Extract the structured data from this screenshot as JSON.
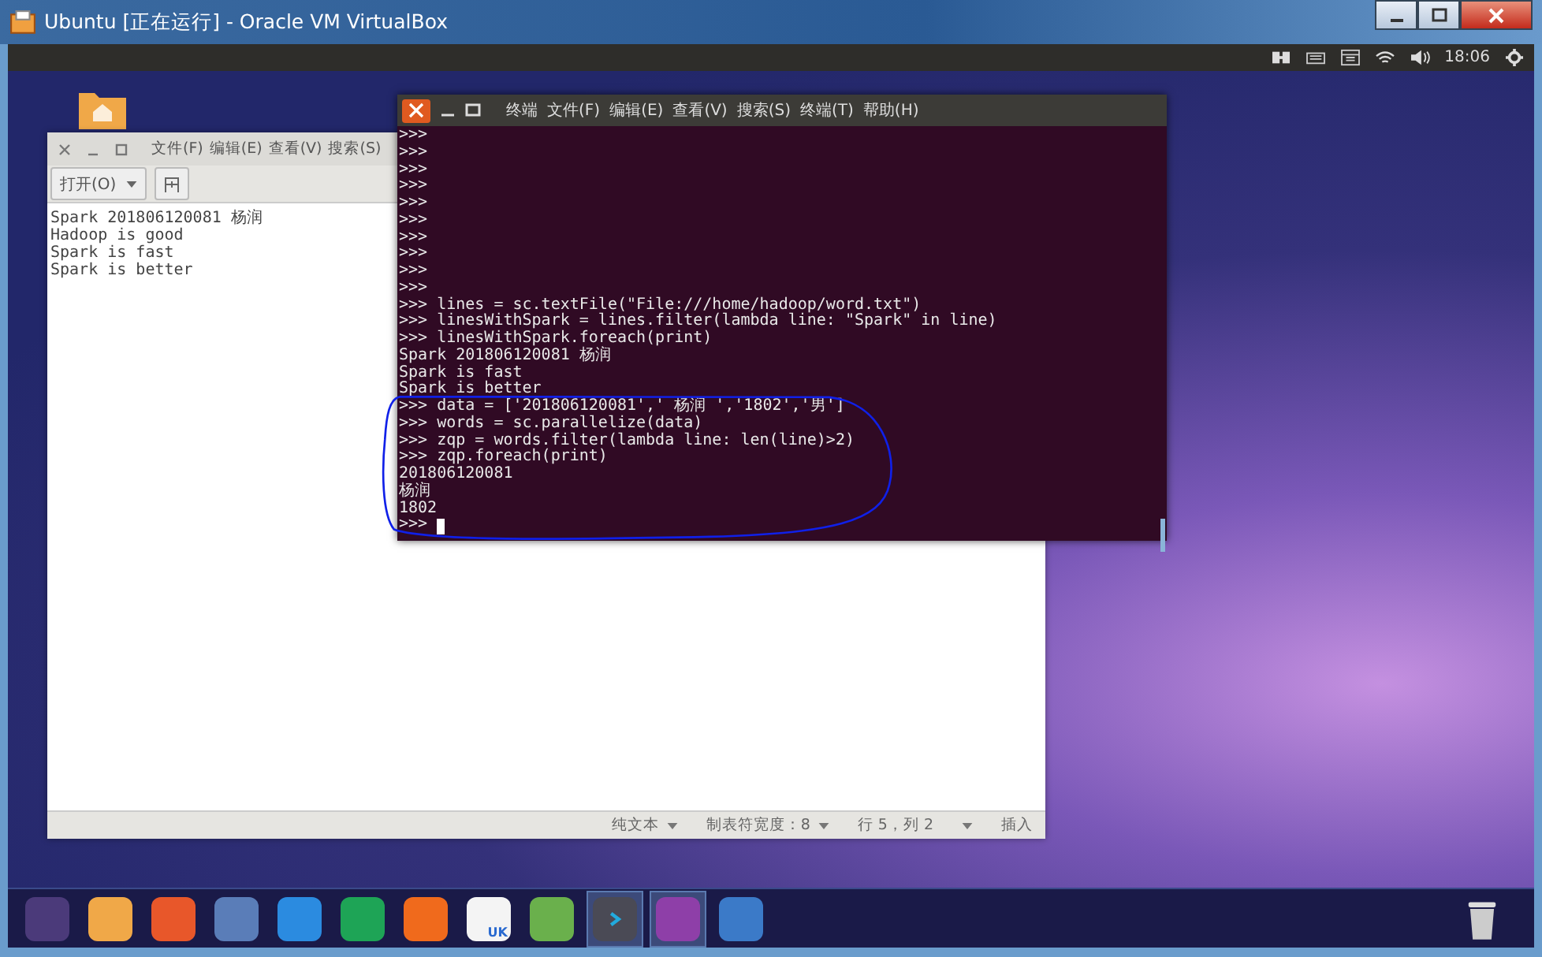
{
  "window": {
    "title": "Ubuntu [正在运行] - Oracle VM VirtualBox"
  },
  "top_panel": {
    "time": "18:06"
  },
  "gedit": {
    "menu": [
      "文件(F)",
      "编辑(E)",
      "查看(V)",
      "搜索(S)"
    ],
    "open_button": "打开(O)",
    "lines": [
      "Spark 201806120081 杨润",
      "Hadoop is good",
      "Spark is fast",
      "Spark is better"
    ],
    "status": [
      {
        "label": "纯文本",
        "dropdown": true
      },
      {
        "label": "制表符宽度：8",
        "dropdown": true
      },
      {
        "label": "行 5，列 2",
        "dropdown": false
      },
      {
        "dropdown": true
      },
      {
        "label": "插入",
        "dropdown": false
      }
    ]
  },
  "terminal": {
    "title": "终端",
    "menu": [
      "文件(F)",
      "编辑(E)",
      "查看(V)",
      "搜索(S)",
      "终端(T)",
      "帮助(H)"
    ],
    "lines": [
      ">>>",
      ">>>",
      ">>>",
      ">>>",
      ">>>",
      ">>>",
      ">>>",
      ">>>",
      ">>>",
      ">>>",
      ">>> lines = sc.textFile(\"File:///home/hadoop/word.txt\")",
      ">>> linesWithSpark = lines.filter(lambda line: \"Spark\" in line)",
      ">>> linesWithSpark.foreach(print)",
      "Spark 201806120081 杨润",
      "Spark is fast",
      "Spark is better",
      ">>> data = ['201806120081',' 杨润 ','1802','男']",
      ">>> words = sc.parallelize(data)",
      ">>> zqp = words.filter(lambda line: len(line)>2)",
      ">>> zqp.foreach(print)",
      "201806120081",
      "杨润",
      "1802",
      ">>> "
    ]
  },
  "dock": [
    {
      "kind": "launcher",
      "selected": false
    },
    {
      "kind": "files",
      "selected": false
    },
    {
      "kind": "firefox",
      "selected": false
    },
    {
      "kind": "chromium",
      "selected": false
    },
    {
      "kind": "word",
      "selected": false
    },
    {
      "kind": "excel",
      "selected": false
    },
    {
      "kind": "powerpoint",
      "selected": false
    },
    {
      "kind": "store",
      "label": "UK",
      "selected": false
    },
    {
      "kind": "installer",
      "selected": false
    },
    {
      "kind": "terminal",
      "selected": true
    },
    {
      "kind": "editor",
      "selected": true
    },
    {
      "kind": "workspaces",
      "selected": false
    }
  ]
}
